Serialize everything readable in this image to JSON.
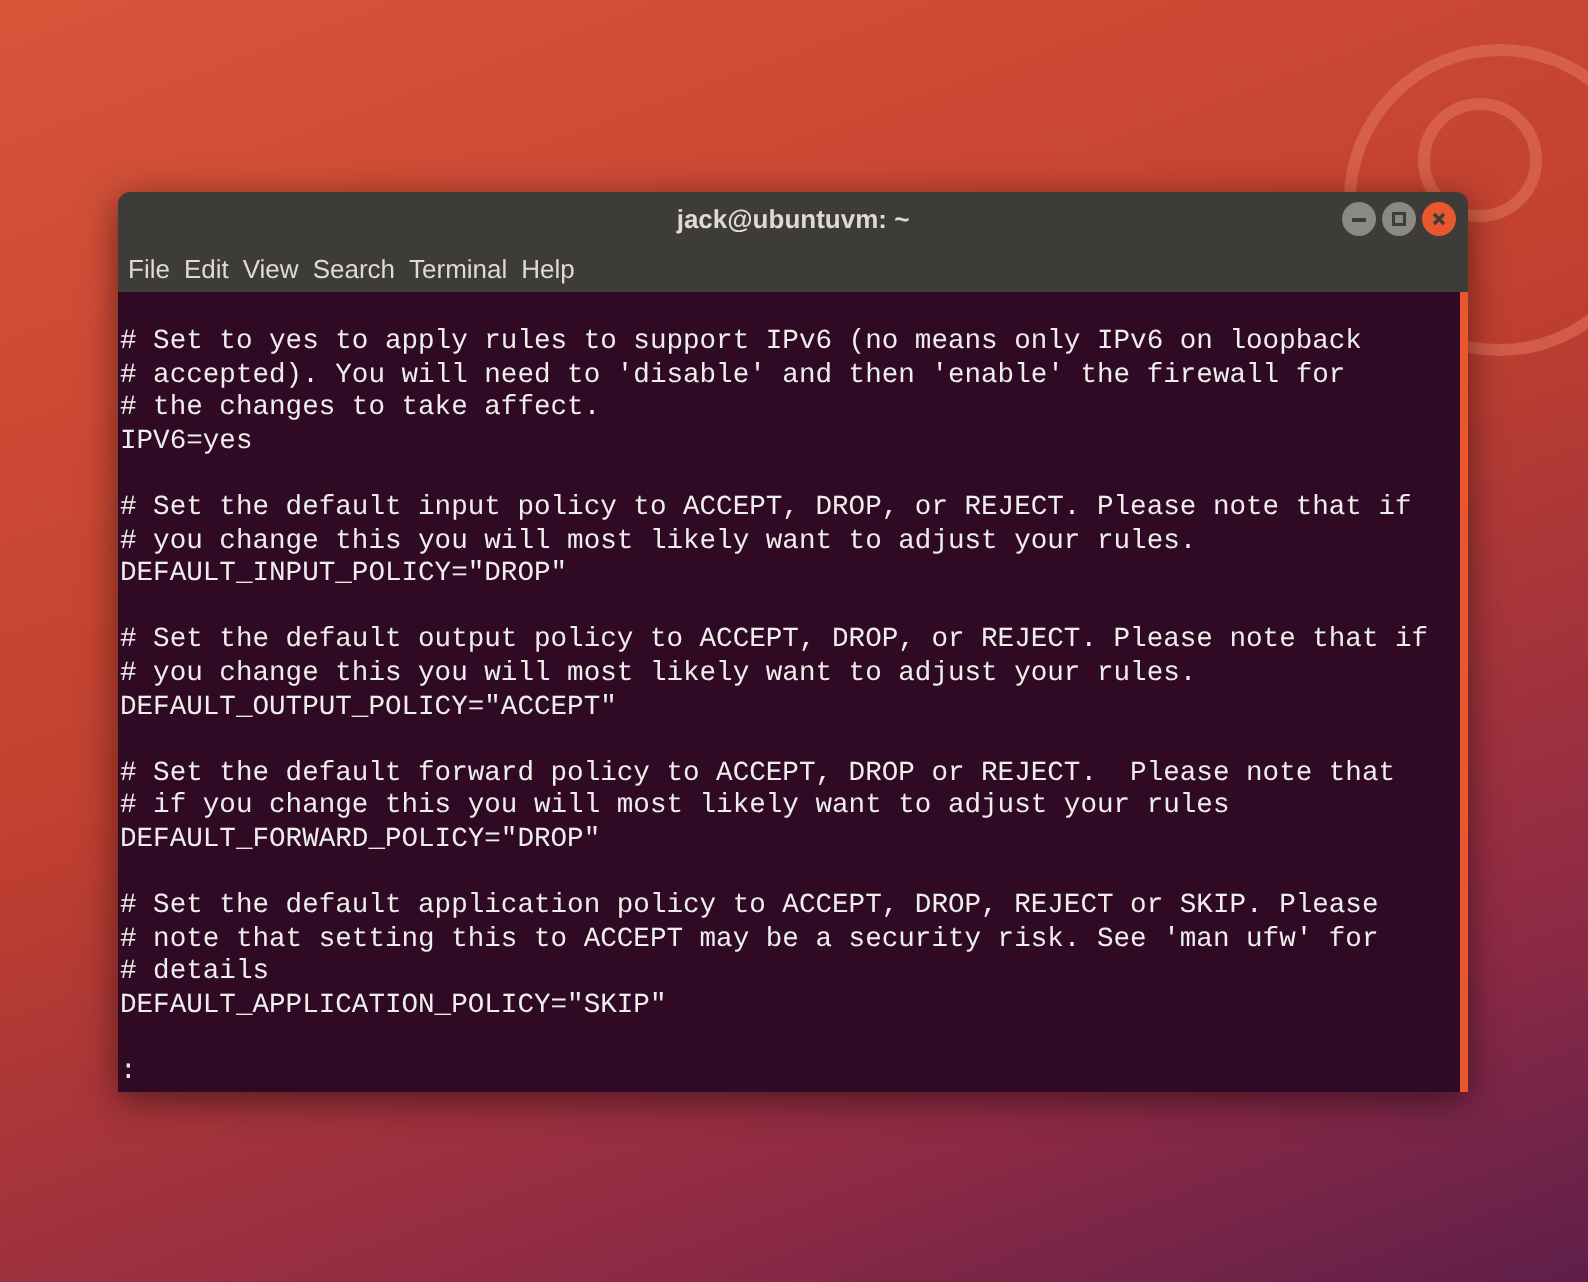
{
  "window": {
    "title": "jack@ubuntuvm: ~"
  },
  "menu": [
    {
      "label": "File"
    },
    {
      "label": "Edit"
    },
    {
      "label": "View"
    },
    {
      "label": "Search"
    },
    {
      "label": "Terminal"
    },
    {
      "label": "Help"
    }
  ],
  "terminal": {
    "blocks": [
      [
        "# Set to yes to apply rules to support IPv6 (no means only IPv6 on loopback",
        "# accepted). You will need to 'disable' and then 'enable' the firewall for",
        "# the changes to take affect.",
        "IPV6=yes"
      ],
      [
        "# Set the default input policy to ACCEPT, DROP, or REJECT. Please note that if",
        "# you change this you will most likely want to adjust your rules.",
        "DEFAULT_INPUT_POLICY=\"DROP\""
      ],
      [
        "# Set the default output policy to ACCEPT, DROP, or REJECT. Please note that if",
        "# you change this you will most likely want to adjust your rules.",
        "DEFAULT_OUTPUT_POLICY=\"ACCEPT\""
      ],
      [
        "# Set the default forward policy to ACCEPT, DROP or REJECT.  Please note that",
        "# if you change this you will most likely want to adjust your rules",
        "DEFAULT_FORWARD_POLICY=\"DROP\""
      ],
      [
        "# Set the default application policy to ACCEPT, DROP, REJECT or SKIP. Please",
        "# note that setting this to ACCEPT may be a security risk. See 'man ufw' for",
        "# details",
        "DEFAULT_APPLICATION_POLICY=\"SKIP\""
      ]
    ],
    "prompt": ":"
  }
}
